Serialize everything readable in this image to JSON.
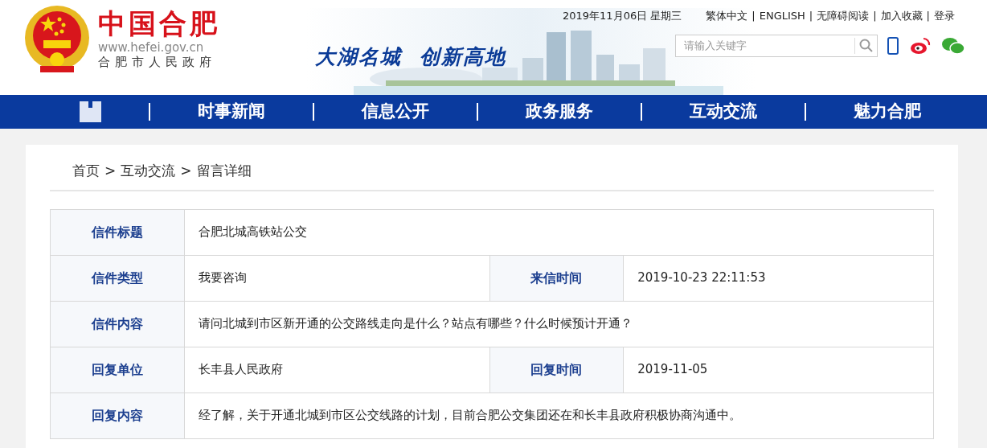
{
  "site": {
    "title": "中国合肥",
    "url": "www.hefei.gov.cn",
    "subtitle": "合肥市人民政府"
  },
  "banner": {
    "slogan_1": "大湖名城",
    "slogan_2": "创新高地"
  },
  "date": "2019年11月06日 星期三",
  "top_links": [
    {
      "label": "繁体中文"
    },
    {
      "separator": "|",
      "label": "ENGLISH"
    },
    {
      "separator": "|",
      "label": "无障碍阅读"
    },
    {
      "separator": "|",
      "label": "加入收藏"
    },
    {
      "separator": "|",
      "label": "登录"
    }
  ],
  "search": {
    "placeholder": "请输入关键字"
  },
  "nav": [
    {
      "label": "时事新闻"
    },
    {
      "label": "信息公开"
    },
    {
      "label": "政务服务"
    },
    {
      "label": "互动交流"
    },
    {
      "label": "魅力合肥"
    }
  ],
  "breadcrumb": [
    {
      "label": "首页"
    },
    {
      "separator": ">",
      "label": "互动交流"
    },
    {
      "separator": ">",
      "label": "留言详细"
    }
  ],
  "table": {
    "rows": [
      {
        "cells": [
          {
            "kind": "label",
            "text": "信件标题"
          },
          {
            "kind": "value",
            "text": "合肥北城高铁站公交",
            "colspan": 3
          }
        ]
      },
      {
        "cells": [
          {
            "kind": "label",
            "text": "信件类型"
          },
          {
            "kind": "value",
            "text": "我要咨询"
          },
          {
            "kind": "label",
            "text": "来信时间"
          },
          {
            "kind": "value",
            "text": "2019-10-23 22:11:53"
          }
        ]
      },
      {
        "cells": [
          {
            "kind": "label",
            "text": "信件内容"
          },
          {
            "kind": "value",
            "text": "请问北城到市区新开通的公交路线走向是什么？站点有哪些？什么时候预计开通？",
            "colspan": 3
          }
        ]
      },
      {
        "cells": [
          {
            "kind": "label",
            "text": "回复单位"
          },
          {
            "kind": "value",
            "text": "长丰县人民政府"
          },
          {
            "kind": "label",
            "text": "回复时间"
          },
          {
            "kind": "value",
            "text": "2019-11-05"
          }
        ]
      },
      {
        "cells": [
          {
            "kind": "label",
            "text": "回复内容"
          },
          {
            "kind": "value",
            "text": "经了解，关于开通北城到市区公交线路的计划，目前合肥公交集团还在和长丰县政府积极协商沟通中。",
            "colspan": 3
          }
        ]
      }
    ]
  }
}
